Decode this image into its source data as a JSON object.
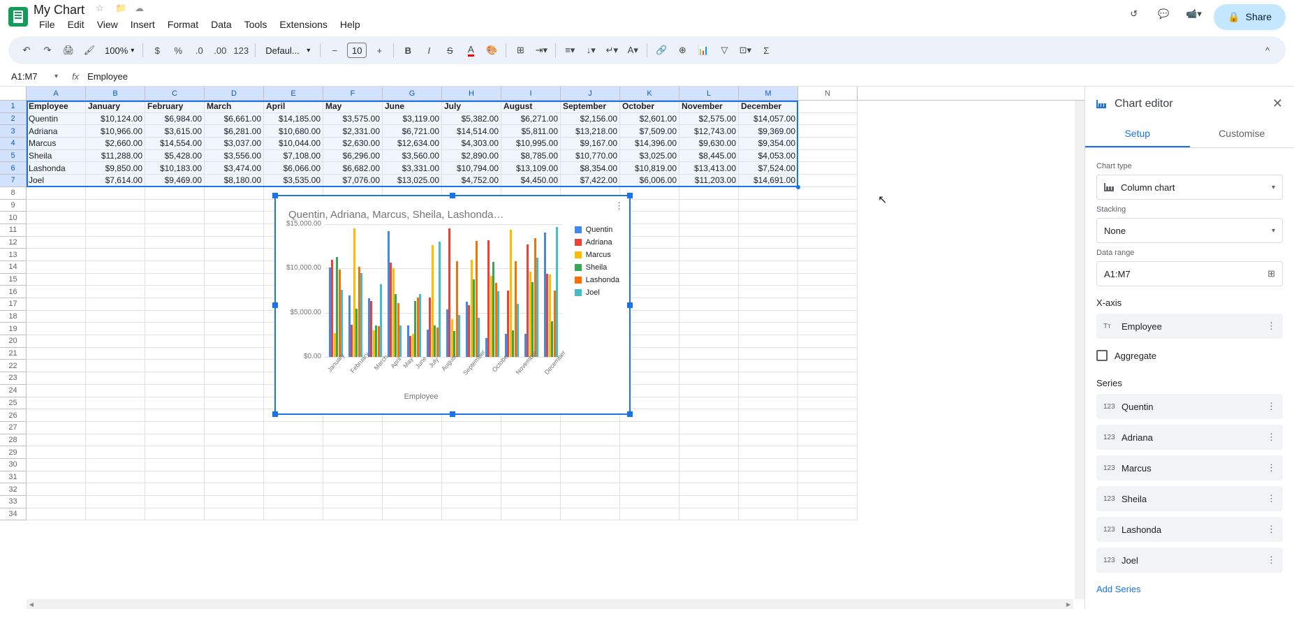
{
  "doc": {
    "title": "My Chart"
  },
  "menu": {
    "file": "File",
    "edit": "Edit",
    "view": "View",
    "insert": "Insert",
    "format": "Format",
    "data": "Data",
    "tools": "Tools",
    "extensions": "Extensions",
    "help": "Help"
  },
  "toolbar": {
    "zoom": "100%",
    "font": "Defaul...",
    "font_size": "10"
  },
  "share": {
    "label": "Share"
  },
  "name_box": "A1:M7",
  "formula": "Employee",
  "columns": [
    "A",
    "B",
    "C",
    "D",
    "E",
    "F",
    "G",
    "H",
    "I",
    "J",
    "K",
    "L",
    "M",
    "N"
  ],
  "table": {
    "headers": [
      "Employee",
      "January",
      "February",
      "March",
      "April",
      "May",
      "June",
      "July",
      "August",
      "September",
      "October",
      "November",
      "December"
    ],
    "rows": [
      [
        "Quentin",
        "$10,124.00",
        "$6,984.00",
        "$6,661.00",
        "$14,185.00",
        "$3,575.00",
        "$3,119.00",
        "$5,382.00",
        "$6,271.00",
        "$2,156.00",
        "$2,601.00",
        "$2,575.00",
        "$14,057.00"
      ],
      [
        "Adriana",
        "$10,966.00",
        "$3,615.00",
        "$6,281.00",
        "$10,680.00",
        "$2,331.00",
        "$6,721.00",
        "$14,514.00",
        "$5,811.00",
        "$13,218.00",
        "$7,509.00",
        "$12,743.00",
        "$9,369.00"
      ],
      [
        "Marcus",
        "$2,660.00",
        "$14,554.00",
        "$3,037.00",
        "$10,044.00",
        "$2,630.00",
        "$12,634.00",
        "$4,303.00",
        "$10,995.00",
        "$9,167.00",
        "$14,396.00",
        "$9,630.00",
        "$9,354.00"
      ],
      [
        "Sheila",
        "$11,288.00",
        "$5,428.00",
        "$3,556.00",
        "$7,108.00",
        "$6,296.00",
        "$3,560.00",
        "$2,890.00",
        "$8,785.00",
        "$10,770.00",
        "$3,025.00",
        "$8,445.00",
        "$4,053.00"
      ],
      [
        "Lashonda",
        "$9,850.00",
        "$10,183.00",
        "$3,474.00",
        "$6,066.00",
        "$6,682.00",
        "$3,331.00",
        "$10,794.00",
        "$13,109.00",
        "$8,354.00",
        "$10,819.00",
        "$13,413.00",
        "$7,524.00"
      ],
      [
        "Joel",
        "$7,614.00",
        "$9,469.00",
        "$8,180.00",
        "$3,535.00",
        "$7,076.00",
        "$13,025.00",
        "$4,752.00",
        "$4,450.00",
        "$7,422.00",
        "$6,006.00",
        "$11,203.00",
        "$14,691.00"
      ]
    ]
  },
  "chart": {
    "title": "Quentin, Adriana, Marcus, Sheila, Lashonda…",
    "x_title": "Employee",
    "y_ticks": [
      "$15,000.00",
      "$10,000.00",
      "$5,000.00",
      "$0.00"
    ],
    "legend": [
      "Quentin",
      "Adriana",
      "Marcus",
      "Sheila",
      "Lashonda",
      "Joel"
    ],
    "colors": [
      "#4285f4",
      "#ea4335",
      "#fbbc04",
      "#34a853",
      "#ff6d01",
      "#46bdc6"
    ]
  },
  "chart_data": {
    "type": "bar",
    "title": "Quentin, Adriana, Marcus, Sheila, Lashonda…",
    "xlabel": "Employee",
    "ylabel": "",
    "ylim": [
      0,
      15000
    ],
    "categories": [
      "January",
      "February",
      "March",
      "April",
      "May",
      "June",
      "July",
      "August",
      "September",
      "October",
      "November",
      "December"
    ],
    "series": [
      {
        "name": "Quentin",
        "values": [
          10124,
          6984,
          6661,
          14185,
          3575,
          3119,
          5382,
          6271,
          2156,
          2601,
          2575,
          14057
        ]
      },
      {
        "name": "Adriana",
        "values": [
          10966,
          3615,
          6281,
          10680,
          2331,
          6721,
          14514,
          5811,
          13218,
          7509,
          12743,
          9369
        ]
      },
      {
        "name": "Marcus",
        "values": [
          2660,
          14554,
          3037,
          10044,
          2630,
          12634,
          4303,
          10995,
          9167,
          14396,
          9630,
          9354
        ]
      },
      {
        "name": "Sheila",
        "values": [
          11288,
          5428,
          3556,
          7108,
          6296,
          3560,
          2890,
          8785,
          10770,
          3025,
          8445,
          4053
        ]
      },
      {
        "name": "Lashonda",
        "values": [
          9850,
          10183,
          3474,
          6066,
          6682,
          3331,
          10794,
          13109,
          8354,
          10819,
          13413,
          7524
        ]
      },
      {
        "name": "Joel",
        "values": [
          7614,
          9469,
          8180,
          3535,
          7076,
          13025,
          4752,
          4450,
          7422,
          6006,
          11203,
          14691
        ]
      }
    ]
  },
  "editor": {
    "title": "Chart editor",
    "tabs": {
      "setup": "Setup",
      "customise": "Customise"
    },
    "chart_type_label": "Chart type",
    "chart_type_value": "Column chart",
    "stacking_label": "Stacking",
    "stacking_value": "None",
    "data_range_label": "Data range",
    "data_range_value": "A1:M7",
    "xaxis_label": "X-axis",
    "xaxis_value": "Employee",
    "aggregate_label": "Aggregate",
    "series_label": "Series",
    "series": [
      "Quentin",
      "Adriana",
      "Marcus",
      "Sheila",
      "Lashonda",
      "Joel"
    ],
    "add_series": "Add Series"
  }
}
